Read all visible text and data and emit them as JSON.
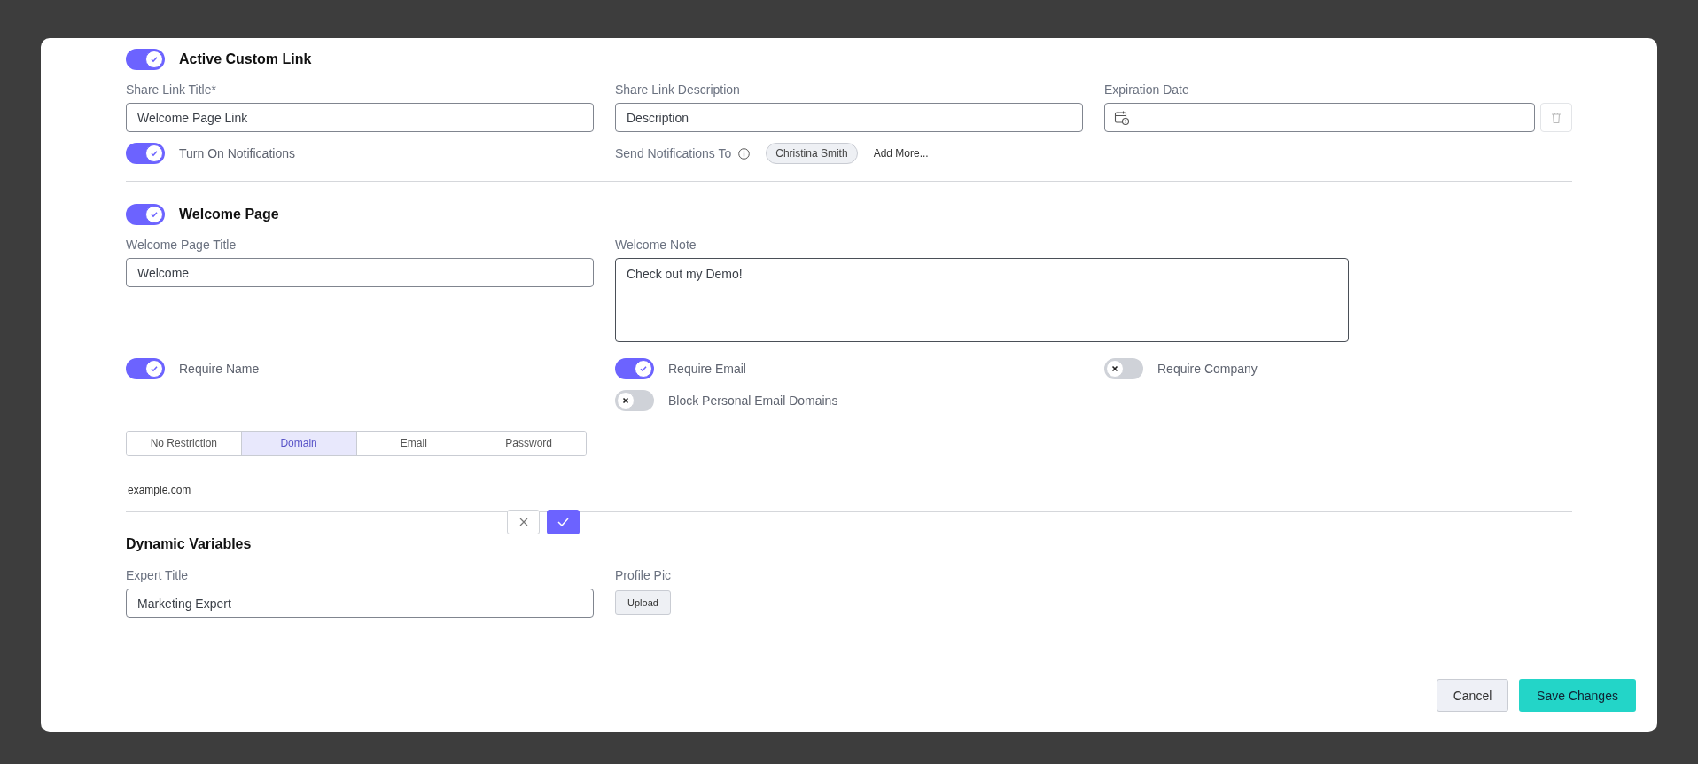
{
  "custom_link": {
    "toggle": {
      "label": "Active Custom Link",
      "on": true
    },
    "title_field": {
      "label": "Share Link Title*",
      "value": "Welcome Page Link"
    },
    "description_field": {
      "label": "Share Link Description",
      "value": "Description"
    },
    "expiration": {
      "label": "Expiration Date"
    },
    "notifications": {
      "label": "Turn On Notifications",
      "on": true
    },
    "send_to": {
      "label": "Send Notifications To",
      "recipients": [
        "Christina Smith"
      ],
      "add_more": "Add More..."
    }
  },
  "welcome_page": {
    "toggle": {
      "label": "Welcome Page",
      "on": true
    },
    "title_field": {
      "label": "Welcome Page Title",
      "value": "Welcome"
    },
    "note_field": {
      "label": "Welcome Note",
      "value": "Check out my Demo!"
    },
    "requirement_columns": [
      {
        "toggles": [
          {
            "label": "Require Name",
            "on": true
          }
        ]
      },
      {
        "toggles": [
          {
            "label": "Require Email",
            "on": true
          },
          {
            "label": "Block Personal Email Domains",
            "on": false
          }
        ]
      },
      {
        "toggles": [
          {
            "label": "Require Company",
            "on": false
          }
        ]
      }
    ],
    "restriction_tabs": [
      {
        "label": "No Restriction",
        "selected": false
      },
      {
        "label": "Domain",
        "selected": true
      },
      {
        "label": "Email",
        "selected": false
      },
      {
        "label": "Password",
        "selected": false
      }
    ],
    "domain_value": "example.com"
  },
  "dynamic_variables": {
    "title": "Dynamic Variables",
    "expert_title": {
      "label": "Expert Title",
      "value": "Marketing Expert"
    },
    "profile_pic": {
      "label": "Profile Pic",
      "button": "Upload"
    }
  },
  "footer": {
    "cancel": "Cancel",
    "save": "Save Changes"
  }
}
